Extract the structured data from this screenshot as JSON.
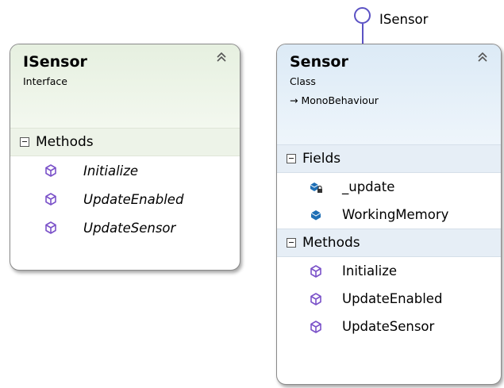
{
  "lollipop": {
    "label": "ISensor"
  },
  "isensor": {
    "title": "ISensor",
    "kind": "Interface",
    "collapse_glyph": "˄˄",
    "methods_section": "Methods",
    "methods": [
      "Initialize",
      "UpdateEnabled",
      "UpdateSensor"
    ]
  },
  "sensor": {
    "title": "Sensor",
    "kind": "Class",
    "base": "→ MonoBehaviour",
    "collapse_glyph": "˄˄",
    "fields_section": "Fields",
    "fields": [
      "_update",
      "WorkingMemory"
    ],
    "methods_section": "Methods",
    "methods": [
      "Initialize",
      "UpdateEnabled",
      "UpdateSensor"
    ]
  },
  "colors": {
    "method_icon": "#7b52c9",
    "field_icon": "#1f6fb5",
    "realization": "#5b52c4"
  },
  "icons": {
    "method": "method-cube-icon",
    "field": "field-icon",
    "private_field": "private-field-icon",
    "section_toggle": "collapse-minus-icon"
  }
}
